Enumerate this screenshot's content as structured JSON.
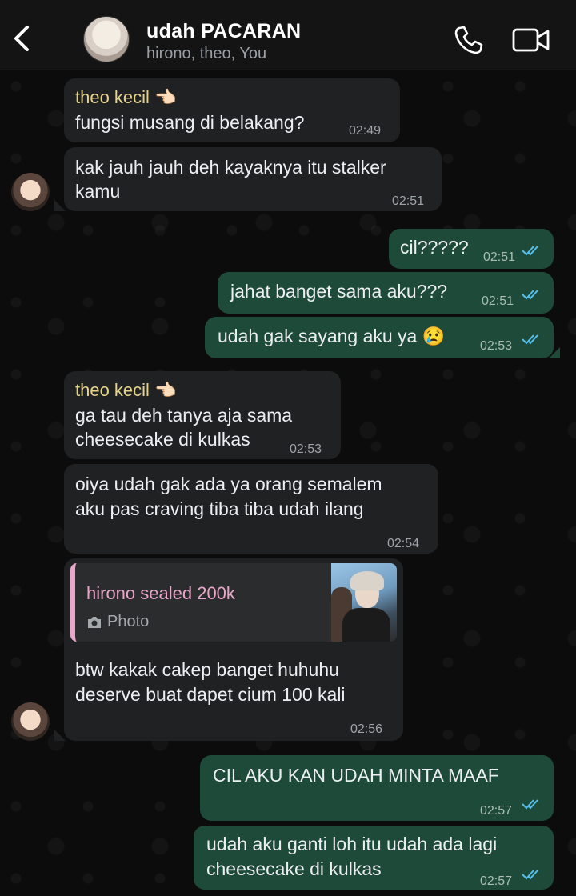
{
  "header": {
    "title": "udah PACARAN",
    "subtitle": "hirono, theo, You"
  },
  "messages": [
    {
      "sender": "theo kecil 👈🏻",
      "text": "fungsi musang di belakang?",
      "time": "02:49"
    },
    {
      "line1": "kak jauh jauh deh kayaknya itu stalker",
      "line2": "kamu",
      "time": "02:51"
    },
    {
      "text": "cil?????",
      "time": "02:51"
    },
    {
      "text": "jahat banget sama aku???",
      "time": "02:51"
    },
    {
      "text": "udah gak sayang aku ya 😢",
      "time": "02:53"
    },
    {
      "sender": "theo kecil 👈🏻",
      "line1": "ga tau deh tanya aja sama",
      "line2": "cheesecake di kulkas",
      "time": "02:53"
    },
    {
      "line1": "oiya udah gak ada ya orang semalem",
      "line2": "aku pas craving tiba tiba udah ilang",
      "time": "02:54"
    },
    {
      "reply_title": "hirono sealed 200k",
      "reply_type": "Photo",
      "line1": "btw kakak cakep banget huhuhu",
      "line2": "deserve buat dapet cium 100 kali",
      "time": "02:56"
    },
    {
      "text": "CIL AKU KAN UDAH MINTA MAAF",
      "time": "02:57"
    },
    {
      "line1": "udah aku ganti loh itu udah ada lagi",
      "line2": "cheesecake di kulkas",
      "time": "02:57"
    }
  ],
  "colors": {
    "incoming_bubble": "#1f2123",
    "outgoing_bubble": "#1e4a3a",
    "sender_name": "#e6d38a",
    "reply_accent": "#e8a6c9",
    "read_ticks": "#53bdeb"
  },
  "icons": {
    "back": "chevron-left-icon",
    "call": "phone-icon",
    "video": "video-camera-icon",
    "photo": "camera-icon",
    "read": "double-check-icon"
  }
}
